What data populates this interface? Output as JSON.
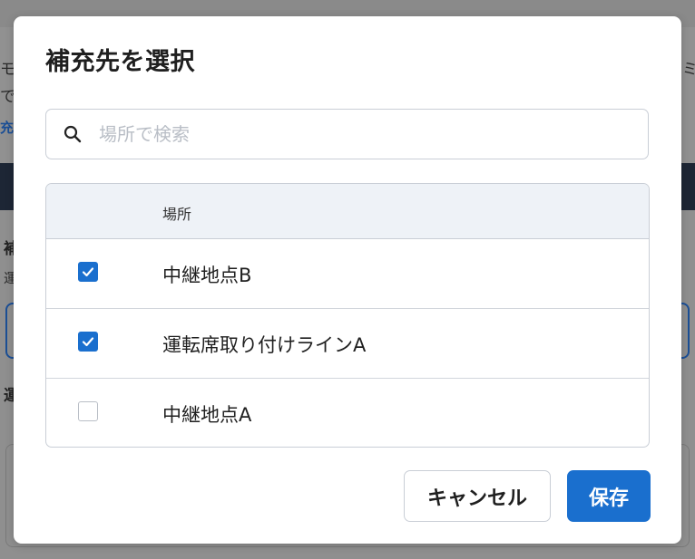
{
  "background": {
    "fragments": {
      "top_left_1": "モ",
      "top_left_2": "で",
      "top_left_link": "充",
      "top_right": "ミ",
      "mid_left_bold": "補",
      "mid_left_2": "運",
      "lower_left_bold": "運"
    }
  },
  "modal": {
    "title": "補充先を選択",
    "search": {
      "placeholder": "場所で検索",
      "value": ""
    },
    "table": {
      "header": "場所",
      "rows": [
        {
          "label": "中継地点B",
          "checked": true
        },
        {
          "label": "運転席取り付けラインA",
          "checked": true
        },
        {
          "label": "中継地点A",
          "checked": false
        }
      ]
    },
    "buttons": {
      "cancel": "キャンセル",
      "save": "保存"
    }
  },
  "colors": {
    "accent": "#1a6fce",
    "border": "#c9ced6",
    "header_bg": "#eef2f7",
    "overlay": "#8f8f8f"
  },
  "icons": {
    "search": "search-icon",
    "check": "checkmark-icon"
  }
}
